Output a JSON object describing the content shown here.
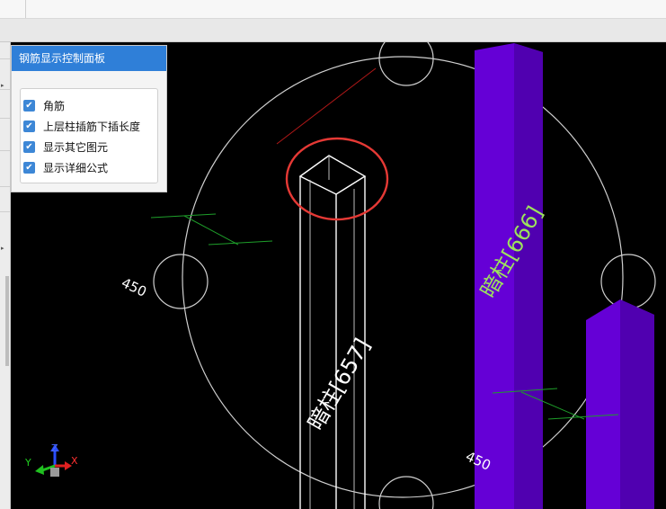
{
  "panel": {
    "title": "钢筋显示控制面板",
    "options": [
      {
        "label": "角筋",
        "checked": true
      },
      {
        "label": "上层柱插筋下插长度",
        "checked": true
      },
      {
        "label": "显示其它图元",
        "checked": true
      },
      {
        "label": "显示详细公式",
        "checked": true
      }
    ]
  },
  "viewport": {
    "labels": {
      "column_center": "暗柱[657]",
      "column_right": "暗柱[666]",
      "dim_left": "450",
      "dim_bottom": "450"
    },
    "axes": {
      "x": "X",
      "y": "Y",
      "z": "Z"
    },
    "colors": {
      "background": "#000000",
      "column_fill": "#6a00d8",
      "highlight_circle": "#e53935",
      "label_green": "#9de45c"
    }
  }
}
